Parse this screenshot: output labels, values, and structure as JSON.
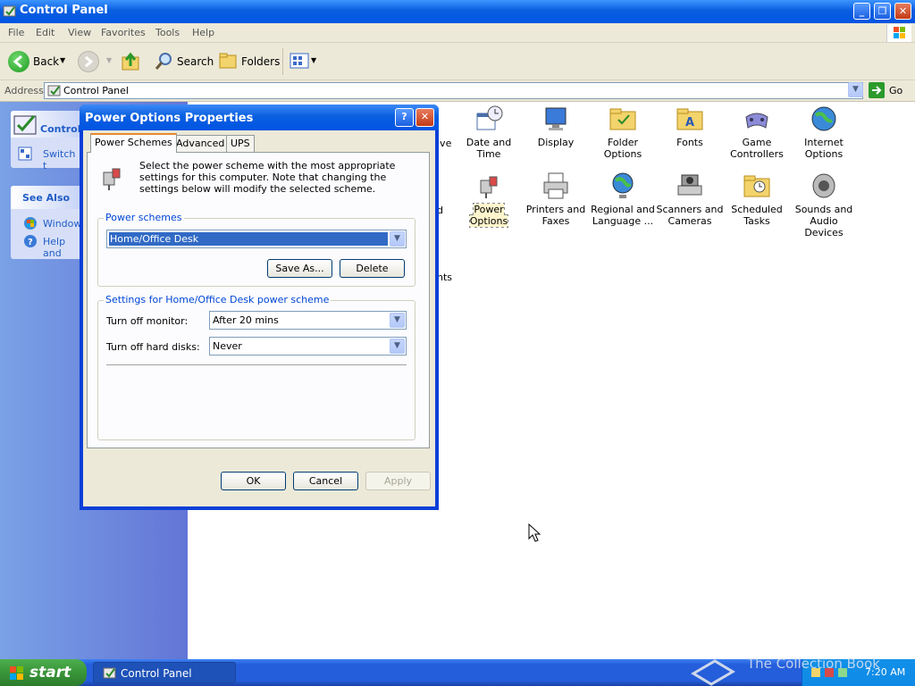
{
  "window": {
    "title": "Control Panel"
  },
  "menu": [
    "File",
    "Edit",
    "View",
    "Favorites",
    "Tools",
    "Help"
  ],
  "toolbar": {
    "back": "Back",
    "search": "Search",
    "folders": "Folders"
  },
  "address": {
    "label": "Address",
    "value": "Control Panel",
    "go": "Go"
  },
  "sidebar": {
    "control_title": "Control",
    "switch_link": "Switch t",
    "see_also": "See Also",
    "links": [
      "Windows",
      "Help and"
    ]
  },
  "icons": {
    "row1_partial": "ive",
    "row1": [
      "Date and Time",
      "Display",
      "Folder Options",
      "Fonts",
      "Game Controllers",
      "Internet Options"
    ],
    "row2_partial": "d",
    "row2": [
      "Power Options",
      "Printers and Faxes",
      "Regional and Language ...",
      "Scanners and Cameras",
      "Scheduled Tasks",
      "Sounds and Audio Devices"
    ],
    "row3_partial": "nts"
  },
  "dialog": {
    "title": "Power Options Properties",
    "help_btn": "?",
    "close_btn": "X",
    "tabs": [
      "Power Schemes",
      "Advanced",
      "UPS"
    ],
    "description": "Select the power scheme with the most appropriate settings for this computer. Note that changing the settings below will modify the selected scheme.",
    "schemes_label": "Power schemes",
    "scheme_value": "Home/Office Desk",
    "save_as": "Save As...",
    "delete": "Delete",
    "settings_label": "Settings for Home/Office Desk power scheme",
    "monitor_label": "Turn off monitor:",
    "monitor_value": "After 20 mins",
    "disks_label": "Turn off hard disks:",
    "disks_value": "Never",
    "ok": "OK",
    "cancel": "Cancel",
    "apply": "Apply"
  },
  "taskbar": {
    "start": "start",
    "task": "Control Panel",
    "clock": "7:20 AM",
    "watermark": "The Collection Book"
  },
  "colors": {
    "titlebar": "#0054e3",
    "taskbar": "#245edb",
    "start": "#3c9a3c",
    "dialog_face": "#ece9d8",
    "accent_label": "#0046d5"
  }
}
